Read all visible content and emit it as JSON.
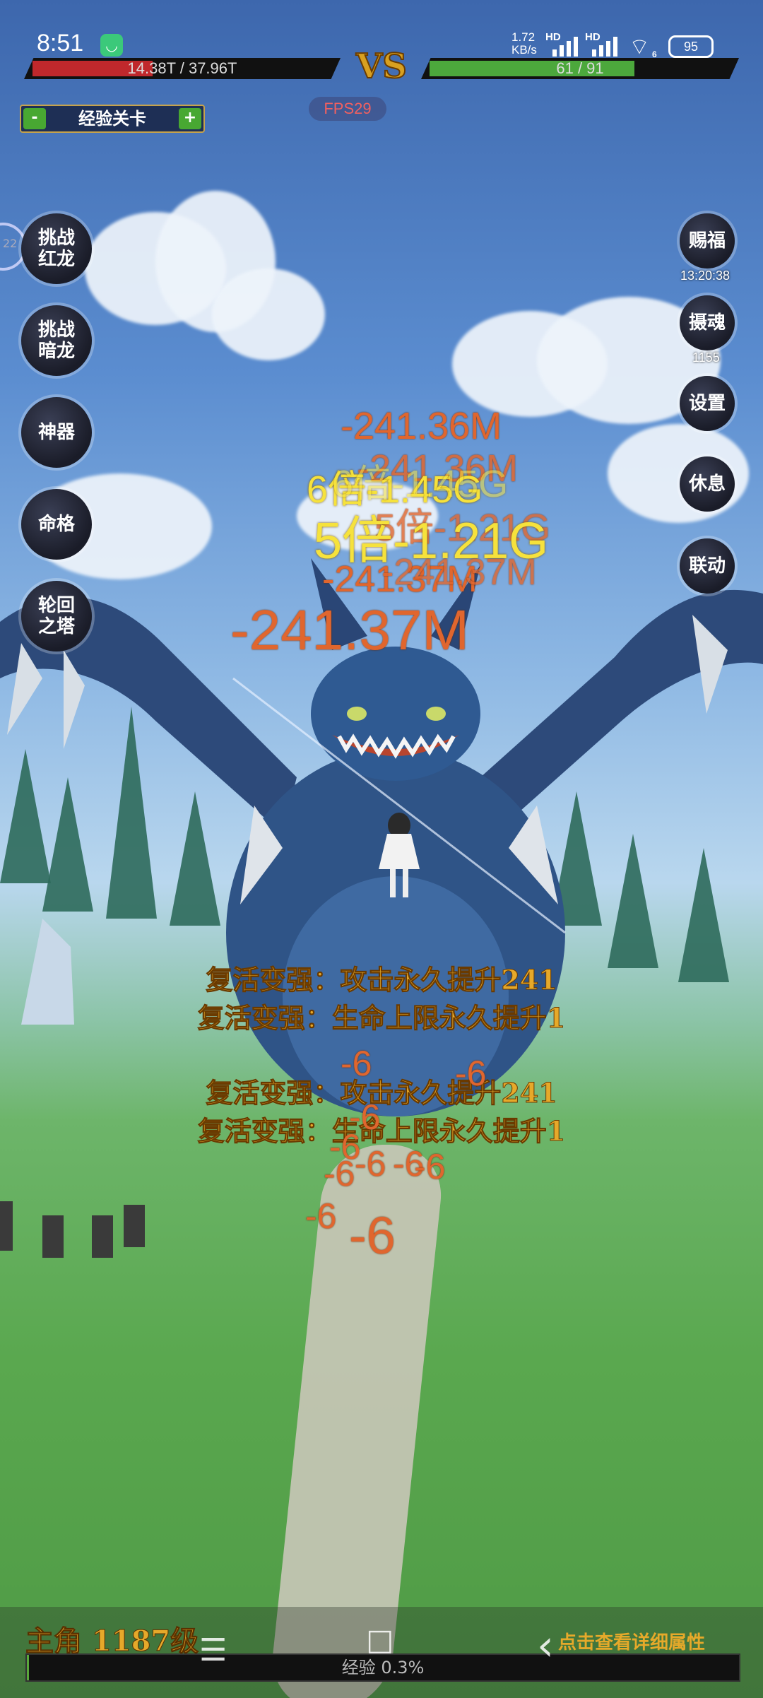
{
  "status_bar": {
    "time": "8:51",
    "net_speed_value": "1.72",
    "net_speed_unit": "KB/s",
    "hd1": "HD",
    "hd2": "HD",
    "sim_label": "6",
    "battery": "95"
  },
  "player_hp": {
    "text": "14.38T / 37.96T",
    "fraction": 0.379
  },
  "enemy_hp": {
    "text": "61 / 91",
    "fraction": 0.67
  },
  "vs_label": "VS",
  "fps": "FPS29",
  "level_selector": {
    "minus": "-",
    "label": "经验关卡",
    "plus": "+"
  },
  "left_buttons": [
    {
      "label_line1": "挑战",
      "label_line2": "红龙"
    },
    {
      "label_line1": "挑战",
      "label_line2": "暗龙"
    },
    {
      "label_line1": "神器",
      "label_line2": ""
    },
    {
      "label_line1": "命格",
      "label_line2": ""
    },
    {
      "label_line1": "轮回",
      "label_line2": "之塔"
    }
  ],
  "left_edge_badge": "22",
  "right_buttons": [
    {
      "label": "赐福",
      "sub": "13:20:38"
    },
    {
      "label": "摄魂",
      "sub": "1155"
    },
    {
      "label": "设置",
      "sub": ""
    },
    {
      "label": "休息",
      "sub": ""
    },
    {
      "label": "联动",
      "sub": ""
    }
  ],
  "floating_damage": {
    "d1": "-241.36M",
    "d2": "-241.36M",
    "d3": "6倍-1.45G",
    "d4": "6倍-1.45G",
    "d5": "5倍-1.21G",
    "d6": "-241.37M",
    "d7": "-241.37M",
    "d8": "-241.37M",
    "d9": "5倍-1.21G",
    "s1": "-6",
    "s2": "-6",
    "s3": "-6",
    "s4": "-6",
    "s5": "-6",
    "s6": "-6",
    "s7": "-6",
    "s8": "-6",
    "s9": "-6",
    "s10": "-6"
  },
  "messages": [
    "复活变强：攻击永久提升241",
    "复活变强：生命上限永久提升1",
    "复活变强：攻击永久提升241",
    "复活变强：生命上限永久提升1"
  ],
  "bottom": {
    "main_role": "主角 1187级",
    "detail_link": "点击查看详细属性",
    "exp_text": "经验 0.3%",
    "exp_fraction": 0.003
  },
  "nav": {
    "menu": "☰",
    "home": "☐",
    "back": "‹"
  }
}
